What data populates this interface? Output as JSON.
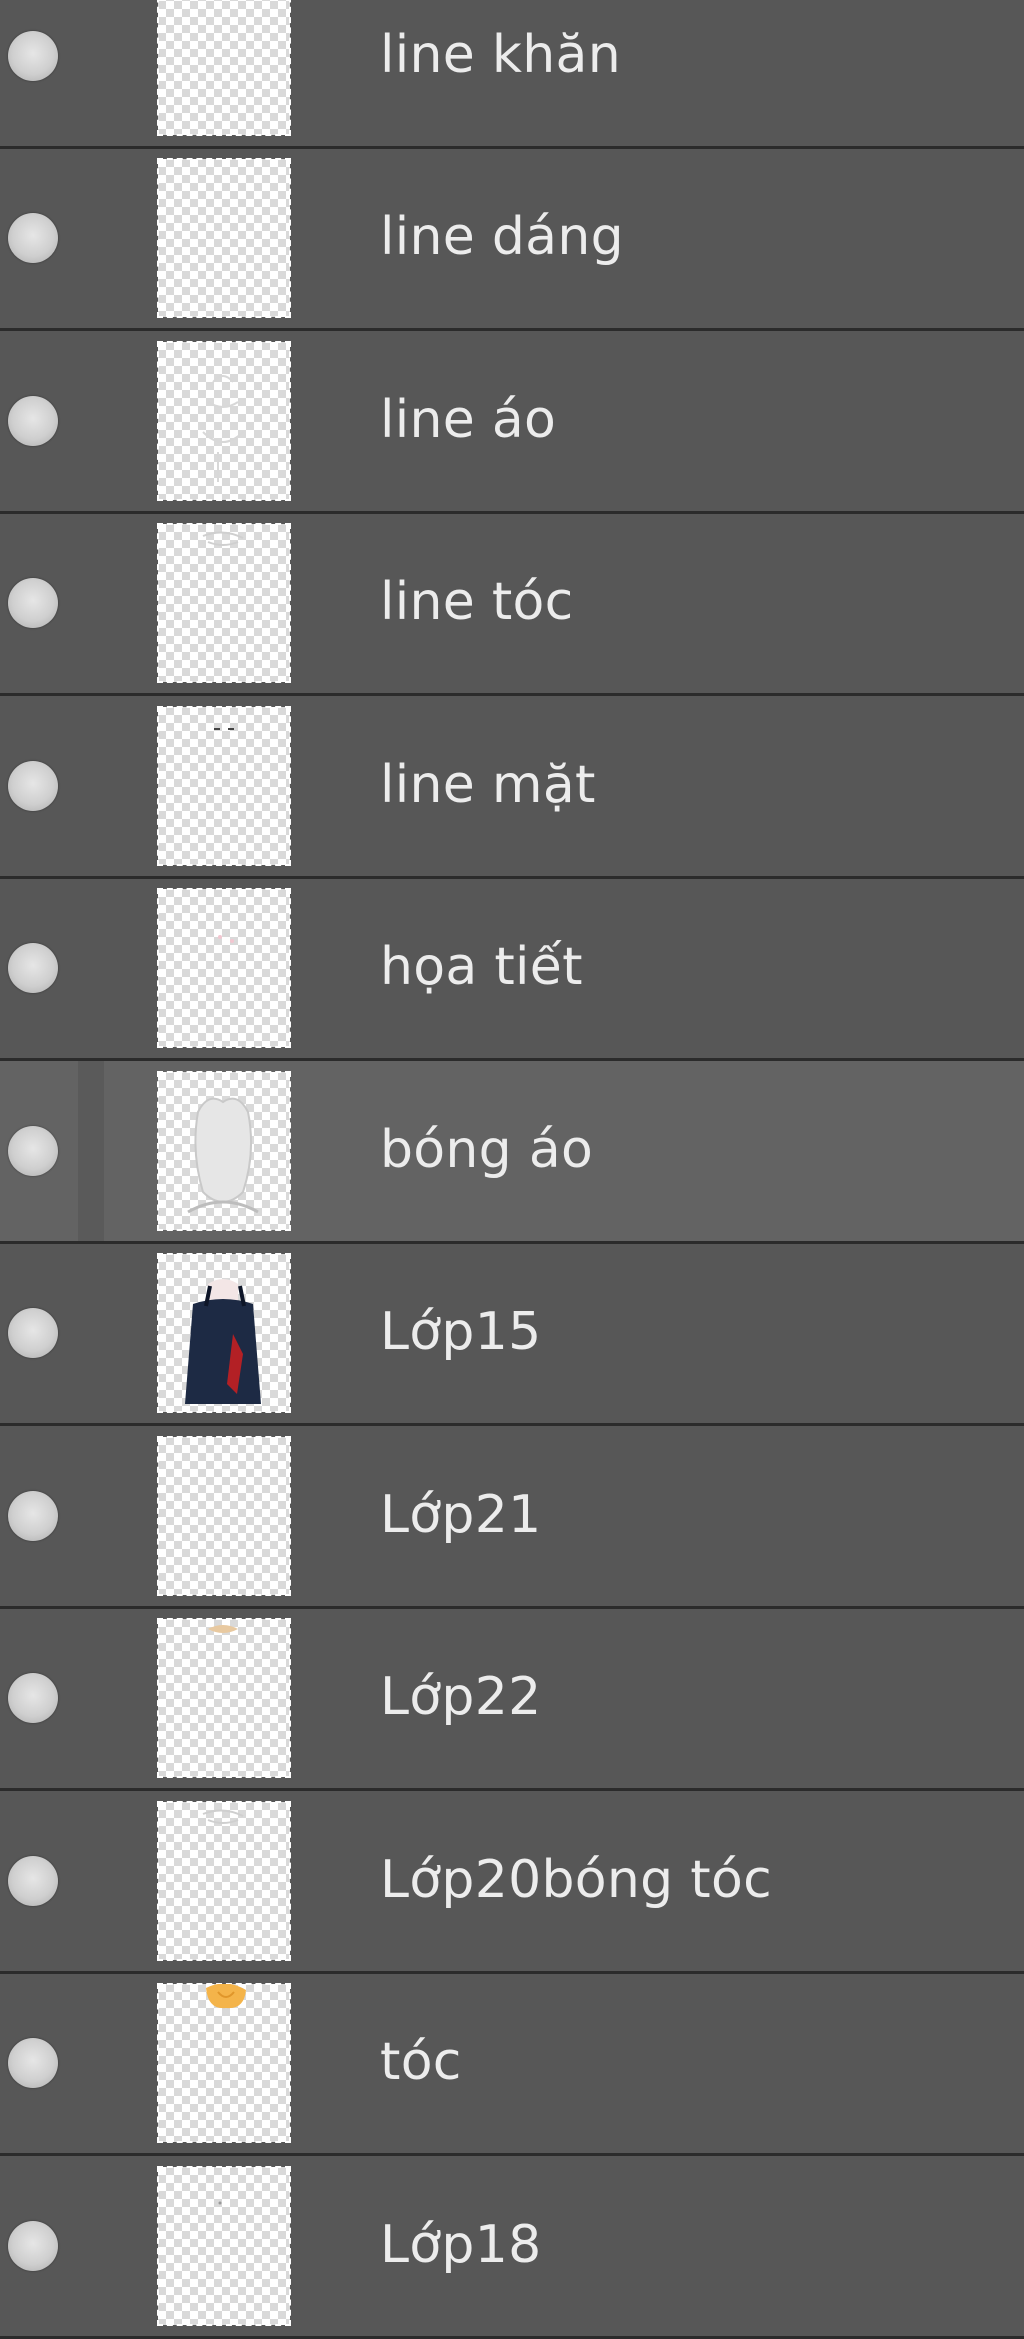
{
  "panel": {
    "layers": [
      {
        "name": "line khăn",
        "visible": true,
        "selected": false,
        "thumb": "empty-transparent"
      },
      {
        "name": "line dáng",
        "visible": true,
        "selected": false,
        "thumb": "empty-transparent"
      },
      {
        "name": "line áo",
        "visible": true,
        "selected": false,
        "thumb": "faint-sketch"
      },
      {
        "name": "line tóc",
        "visible": true,
        "selected": false,
        "thumb": "faint-sketch-top"
      },
      {
        "name": "line mặt",
        "visible": true,
        "selected": false,
        "thumb": "face-lines"
      },
      {
        "name": "họa tiết",
        "visible": true,
        "selected": false,
        "thumb": "pink-dots"
      },
      {
        "name": "bóng áo",
        "visible": true,
        "selected": true,
        "thumb": "grey-shadow-figure"
      },
      {
        "name": "Lớp15",
        "visible": true,
        "selected": false,
        "thumb": "navy-outfit"
      },
      {
        "name": "Lớp21",
        "visible": true,
        "selected": false,
        "thumb": "empty-transparent"
      },
      {
        "name": "Lớp22",
        "visible": true,
        "selected": false,
        "thumb": "small-top-mark"
      },
      {
        "name": "Lớp20bóng tóc",
        "visible": true,
        "selected": false,
        "thumb": "faint-sketch-top"
      },
      {
        "name": "tóc",
        "visible": true,
        "selected": false,
        "thumb": "orange-hair"
      },
      {
        "name": "Lớp18",
        "visible": true,
        "selected": false,
        "thumb": "tiny-dot"
      }
    ]
  }
}
